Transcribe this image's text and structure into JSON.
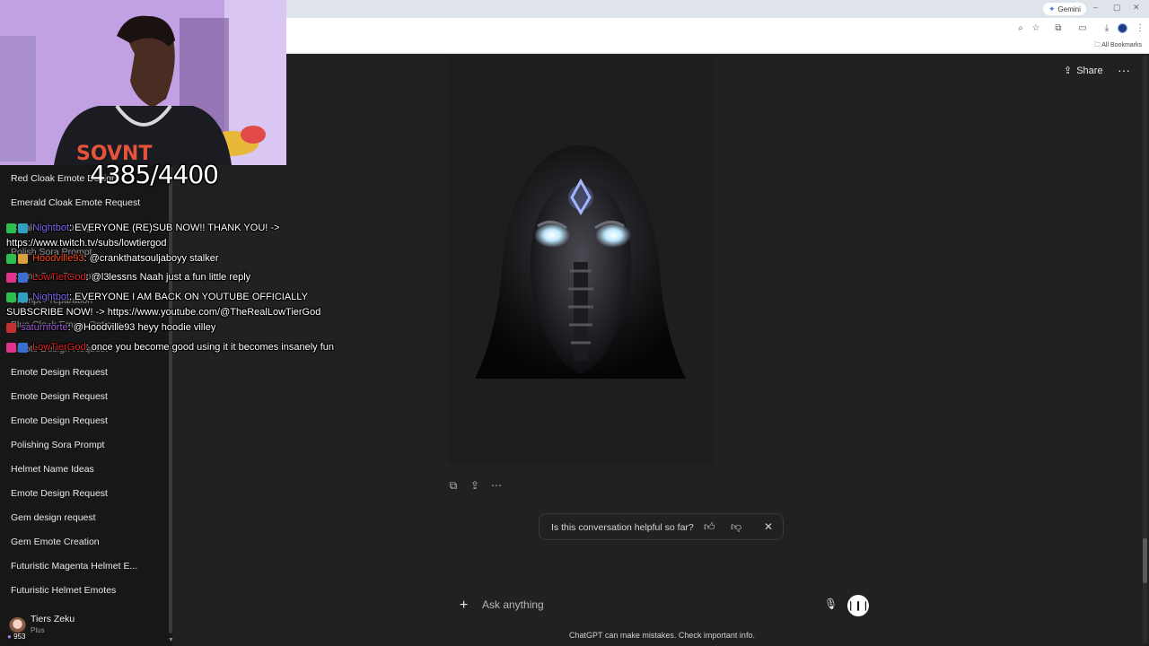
{
  "browser": {
    "gemini_label": "Gemini",
    "all_bookmarks": "All Bookmarks",
    "window_controls": [
      "–",
      "▢",
      "✕"
    ]
  },
  "stream": {
    "sub_counter": "4385/4400",
    "chat": [
      {
        "user": "Nightbot",
        "text": "EVERYONE (RE)SUB NOW!! THANK YOU! ->"
      },
      {
        "user": "",
        "text": "https://www.twitch.tv/subs/lowtiergod"
      },
      {
        "user": "Hoodville93",
        "text": "@crankthatsouljaboyy stalker"
      },
      {
        "user": "LowTierGod",
        "text": "@l3lessns Naah just a fun little reply"
      },
      {
        "user": "Nightbot",
        "text": "EVERYONE I AM BACK ON YOUTUBE OFFICIALLY"
      },
      {
        "user": "",
        "text": "SUBSCRIBE NOW! -> https://www.youtube.com/@TheRealLowTierGod"
      },
      {
        "user": "saturnforte",
        "text": "@Hoodville93 heyy hoodie villey"
      },
      {
        "user": "LowTierGod",
        "text": "once you become good using it it becomes insanely fun"
      }
    ]
  },
  "sidebar": {
    "items": [
      "Red Cloak Emote Design",
      "Emerald Cloak Emote Request",
      "Cloak Emote Design",
      "Polish Sora Prompt",
      "Refine Sora Prompt",
      "Prompt Preparation",
      "Blue Cloak Emote Options",
      "Emote Design Request",
      "Emote Design Request",
      "Emote Design Request",
      "Emote Design Request",
      "Polishing Sora Prompt",
      "Helmet Name Ideas",
      "Emote Design Request",
      "Gem design request",
      "Gem Emote Creation",
      "Futuristic Magenta Helmet E...",
      "Futuristic Helmet Emotes"
    ],
    "user": {
      "name": "Tiers Zeku",
      "plan": "Plus",
      "viewer_count": "953"
    }
  },
  "header": {
    "share_label": "Share",
    "more_label": "···"
  },
  "feedback": {
    "question": "Is this conversation helpful so far?"
  },
  "composer": {
    "placeholder": "Ask anything"
  },
  "footer": {
    "disclaimer": "ChatGPT can make mistakes. Check important info."
  },
  "colors": {
    "background": "#212121",
    "sidebar": "#171717",
    "webcam_bg": "#c4a3e6",
    "eye_glow": "#bfe9ff"
  }
}
